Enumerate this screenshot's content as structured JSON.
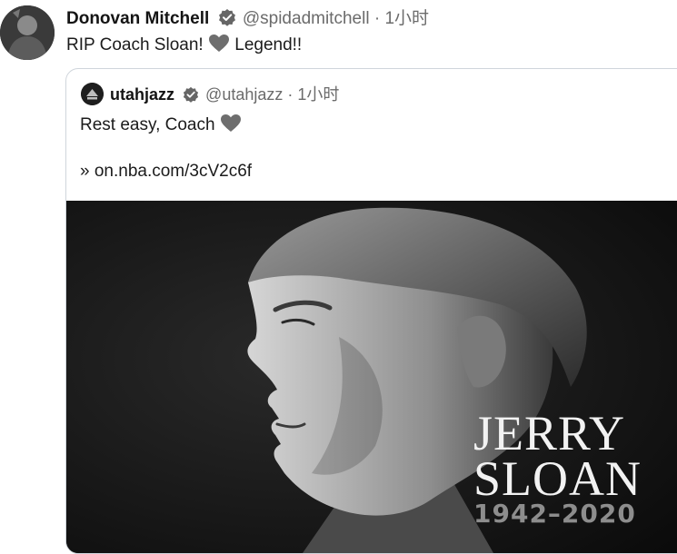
{
  "tweet": {
    "author_name": "Donovan Mitchell",
    "handle": "@spidadmitchell",
    "separator": "·",
    "time": "1小时",
    "text": "RIP Coach Sloan!",
    "text_tail": "Legend!!",
    "heart_icon": "heart-icon"
  },
  "quoted": {
    "author_name": "utahjazz",
    "handle": "@utahjazz",
    "separator": "·",
    "time": "1小时",
    "text": "Rest easy, Coach",
    "link": "» on.nba.com/3cV2c6f"
  },
  "image": {
    "first_name": "JERRY",
    "last_name": "SLOAN",
    "years": "1942–2020"
  },
  "colors": {
    "verified_badge": "#666666",
    "heart": "#6e6e6e",
    "border": "#cfd5db"
  }
}
